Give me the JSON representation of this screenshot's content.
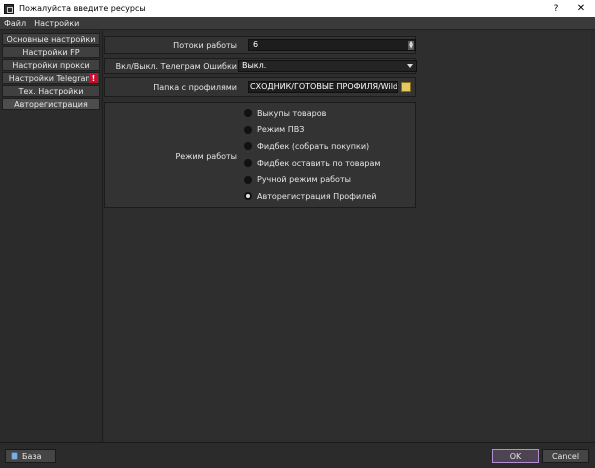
{
  "window": {
    "title": "Пожалуйста введите ресурсы",
    "help_glyph": "?",
    "close_glyph": "✕"
  },
  "menu": [
    "Файл",
    "Настройки"
  ],
  "sidebar": {
    "items": [
      {
        "label": "Основные настройки"
      },
      {
        "label": "Настройки FP"
      },
      {
        "label": "Настройки прокси"
      },
      {
        "label": "Настройки Telegram",
        "badge": "!"
      },
      {
        "label": "Тех. Настройки"
      },
      {
        "label": "Авторегистрация"
      }
    ]
  },
  "fields": {
    "threads": {
      "label": "Потоки работы",
      "value": "6"
    },
    "telegram_errors": {
      "label": "Вкл/Выкл. Телеграм Ошибки",
      "value": "Выкл."
    },
    "profiles_folder": {
      "label": "Папка с профилями",
      "value": "СХОДНИК/ГОТОВЫЕ ПРОФИЛЯ/Wildberries"
    },
    "work_mode": {
      "label": "Режим работы",
      "options": [
        {
          "label": "Выкупы товаров",
          "selected": false
        },
        {
          "label": "Режим ПВЗ",
          "selected": false
        },
        {
          "label": "Фидбек (собрать покупки)",
          "selected": false
        },
        {
          "label": "Фидбек оставить по товарам",
          "selected": false
        },
        {
          "label": "Ручной режим работы",
          "selected": false
        },
        {
          "label": "Авторегистрация Профилей",
          "selected": true
        }
      ]
    }
  },
  "bottom": {
    "base_label": "База",
    "ok_label": "OK",
    "cancel_label": "Cancel"
  },
  "colors": {
    "background": "#2e2e2e",
    "warning_badge": "#c8102e",
    "ok_border": "#b38fd1"
  }
}
